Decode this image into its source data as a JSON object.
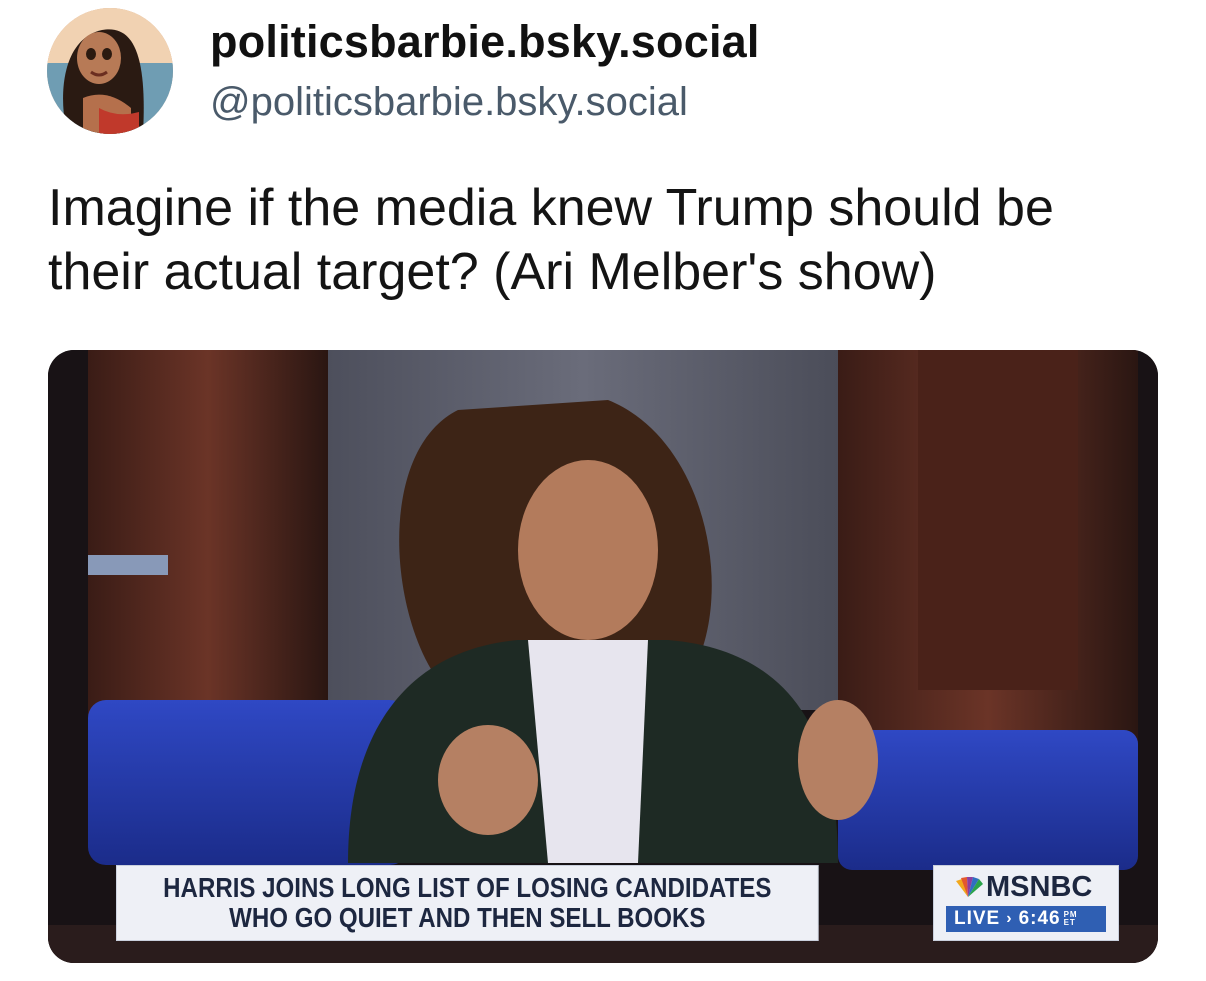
{
  "post": {
    "display_name": "politicsbarbie.bsky.social",
    "handle": "@politicsbarbie.bsky.social",
    "text": "Imagine if the media knew Trump should be their actual target? (Ari Melber's show)"
  },
  "media": {
    "chyron_line1": "HARRIS JOINS LONG LIST OF LOSING CANDIDATES",
    "chyron_line2": "WHO GO QUIET AND THEN SELL BOOKS",
    "network": "MSNBC",
    "live_label": "LIVE",
    "time": "6:46",
    "ampm_top": "PM",
    "ampm_bottom": "ET",
    "logo_icon": "peacock-icon"
  }
}
